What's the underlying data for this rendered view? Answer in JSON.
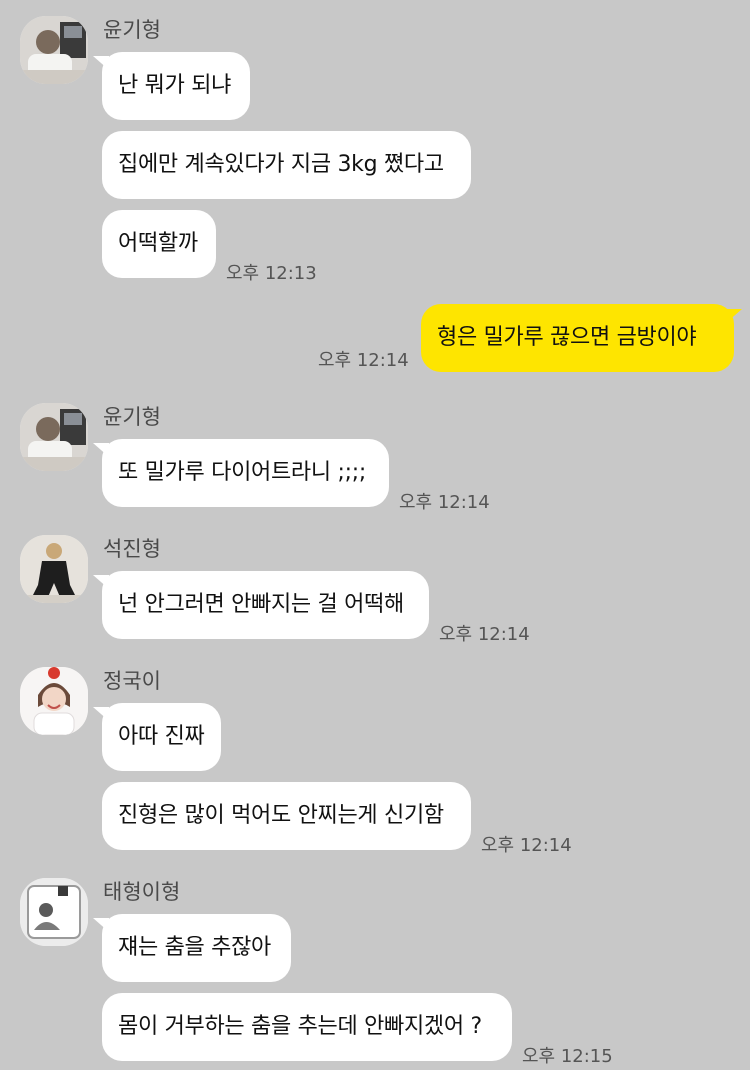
{
  "colors": {
    "background": "#c8c8c8",
    "incoming_bubble": "#ffffff",
    "outgoing_bubble": "#fee500"
  },
  "groups": [
    {
      "sender": "윤기형",
      "avatar_icon": "profile-photo-icon",
      "messages": [
        "난 뭐가 되냐",
        "집에만 계속있다가 지금 3kg 쪘다고",
        "어떡할까"
      ],
      "time": "오후 12:13"
    },
    {
      "outgoing": true,
      "messages": [
        "형은 밀가루 끊으면 금방이야"
      ],
      "time": "오후 12:14"
    },
    {
      "sender": "윤기형",
      "avatar_icon": "profile-photo-icon",
      "messages": [
        "또 밀가루 다이어트라니 ;;;;"
      ],
      "time": "오후 12:14"
    },
    {
      "sender": "석진형",
      "avatar_icon": "profile-photo-icon",
      "messages": [
        "넌 안그러면 안빠지는 걸 어떡해"
      ],
      "time": "오후 12:14"
    },
    {
      "sender": "정국이",
      "avatar_icon": "profile-photo-icon",
      "messages": [
        "아따 진짜",
        "진형은 많이 먹어도 안찌는게 신기함"
      ],
      "time": "오후 12:14"
    },
    {
      "sender": "태형이형",
      "avatar_icon": "profile-photo-icon",
      "messages": [
        "쟤는 춤을 추잖아",
        "몸이 거부하는 춤을 추는데 안빠지겠어 ?"
      ],
      "time": "오후 12:15"
    }
  ]
}
